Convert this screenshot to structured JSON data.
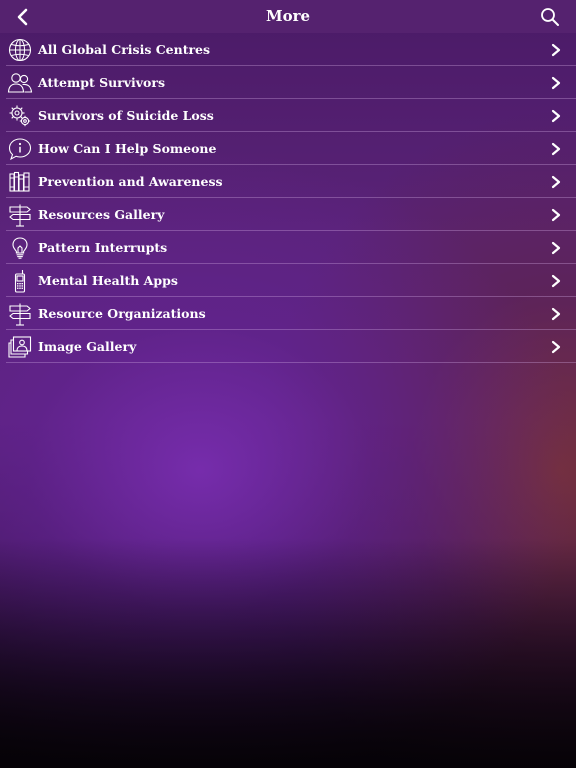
{
  "header": {
    "title": "More",
    "back_icon": "chevron-left-icon",
    "search_icon": "search-icon"
  },
  "menu": {
    "items": [
      {
        "label": "All Global Crisis Centres",
        "icon": "globe-icon"
      },
      {
        "label": "Attempt Survivors",
        "icon": "people-icon"
      },
      {
        "label": "Survivors of Suicide Loss",
        "icon": "gears-icon"
      },
      {
        "label": "How Can I Help Someone",
        "icon": "info-bubble-icon"
      },
      {
        "label": "Prevention and Awareness",
        "icon": "books-icon"
      },
      {
        "label": "Resources Gallery",
        "icon": "signpost-icon"
      },
      {
        "label": "Pattern Interrupts",
        "icon": "lightbulb-icon"
      },
      {
        "label": "Mental Health Apps",
        "icon": "phone-icon"
      },
      {
        "label": "Resource Organizations",
        "icon": "signpost-icon"
      },
      {
        "label": "Image Gallery",
        "icon": "photos-icon"
      }
    ]
  },
  "colors": {
    "header_bg": "#55226f",
    "text": "#ffffff",
    "accent_purple": "#5b237a",
    "accent_maroon": "#783237"
  }
}
